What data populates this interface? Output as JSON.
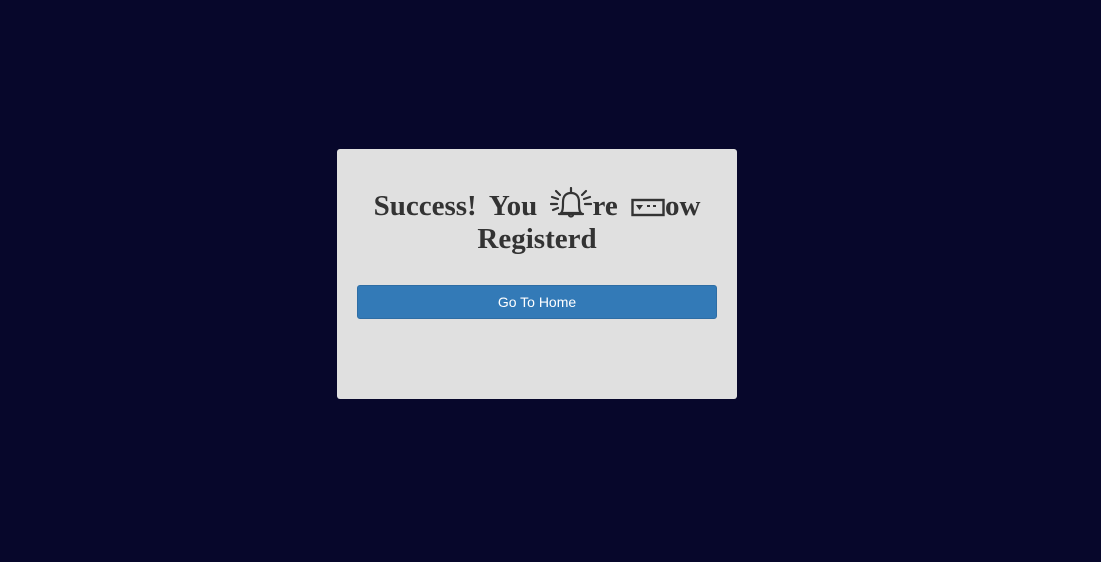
{
  "modal": {
    "heading_part1": "Success! You ",
    "heading_part2": "re ",
    "heading_part3": "ow",
    "heading_line2": "Registerd",
    "icons": [
      "bell-ring-icon",
      "card-icon"
    ],
    "button_label": "Go To Home"
  },
  "colors": {
    "page_background": "#07072b",
    "card_background": "#e0e0e0",
    "heading_text": "#333333",
    "button_background": "#337ab7",
    "button_text": "#ffffff"
  }
}
